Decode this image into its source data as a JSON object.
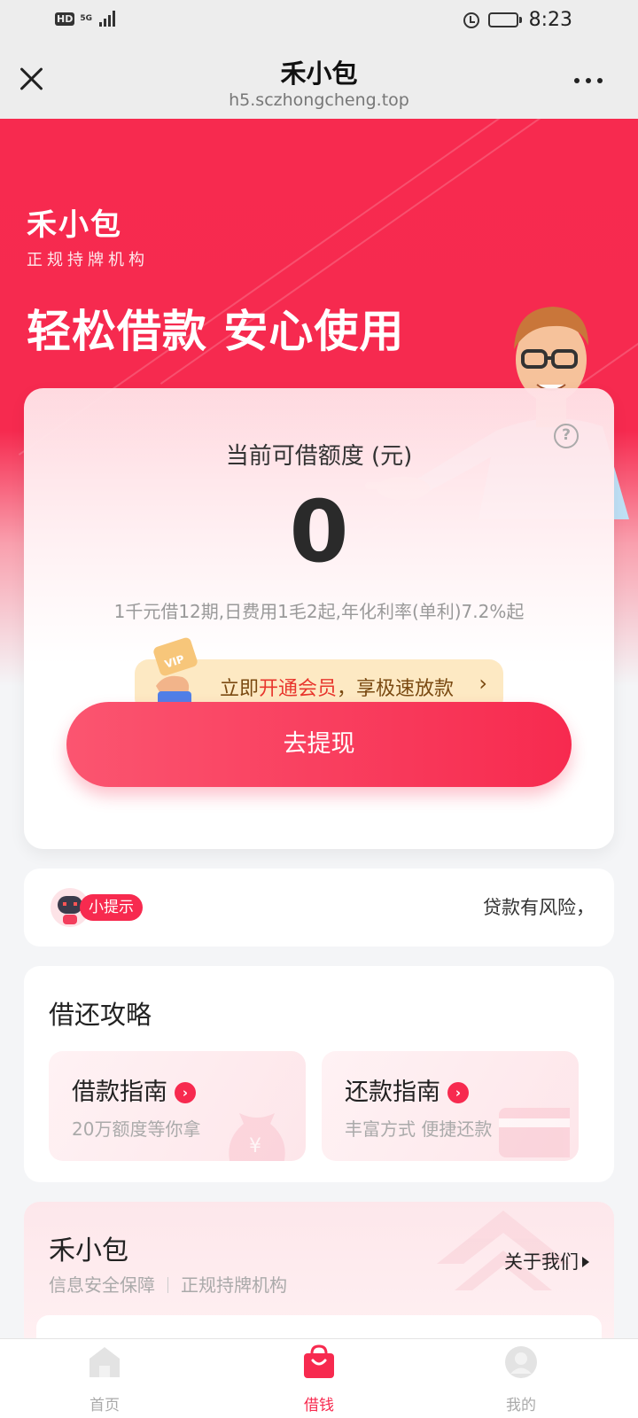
{
  "status_bar": {
    "network_badge": "HD",
    "network_type": "5G",
    "time": "8:23"
  },
  "nav": {
    "title": "禾小包",
    "url": "h5.sczhongcheng.top",
    "close_icon": "close-icon",
    "more_icon": "more-icon"
  },
  "hero": {
    "brand_name": "禾小包",
    "brand_sub": "正规持牌机构",
    "slogan": "轻松借款 安心使用"
  },
  "credit_card": {
    "label": "当前可借额度 (元)",
    "amount": "0",
    "description": "1千元借12期,日费用1毛2起,年化利率(单利)7.2%起",
    "help_icon": "question-icon",
    "vip_prefix": "立即",
    "vip_highlight": "开通会员",
    "vip_suffix": "，享极速放款",
    "vip_chevron": "›",
    "withdraw_button": "去提现"
  },
  "tip": {
    "badge": "小提示",
    "text": "贷款有风险，"
  },
  "guide": {
    "title": "借还攻略",
    "items": [
      {
        "title": "借款指南",
        "subtitle": "20万额度等你拿"
      },
      {
        "title": "还款指南",
        "subtitle": "丰富方式 便捷还款"
      }
    ]
  },
  "about": {
    "title": "禾小包",
    "tag1": "信息安全保障",
    "tag2": "正规持牌机构",
    "link": "关于我们"
  },
  "tabs": [
    {
      "label": "首页",
      "icon": "home-icon",
      "active": false
    },
    {
      "label": "借钱",
      "icon": "shopping-bag-icon",
      "active": true
    },
    {
      "label": "我的",
      "icon": "profile-icon",
      "active": false
    }
  ],
  "colors": {
    "brand_red": "#f72a4f",
    "vip_bg": "#fde9c3",
    "vip_highlight": "#e8362d"
  }
}
